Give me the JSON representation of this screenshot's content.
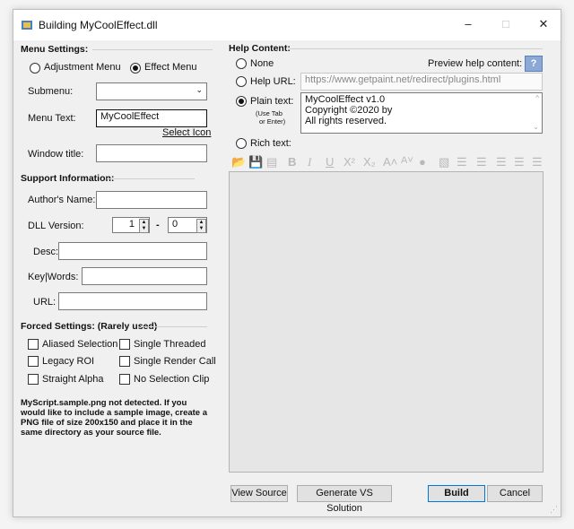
{
  "window": {
    "title": "Building MyCoolEffect.dll",
    "minimize_glyph": "–",
    "maximize_glyph": "□",
    "close_glyph": "✕"
  },
  "menu_settings": {
    "group_label": "Menu Settings:",
    "adjustment_label": "Adjustment Menu",
    "effect_label": "Effect Menu",
    "selected": "Effect Menu",
    "submenu_label": "Submenu:",
    "submenu_value": "",
    "menu_text_label": "Menu Text:",
    "menu_text_value": "MyCoolEffect",
    "select_icon_link": "Select Icon",
    "window_title_label": "Window title:",
    "window_title_value": ""
  },
  "support": {
    "group_label": "Support Information:",
    "author_label": "Author's Name:",
    "author_value": "",
    "dll_version_label": "DLL Version:",
    "version_major": "1",
    "version_sep": "-",
    "version_minor": "0",
    "desc_label": "Desc:",
    "keywords_label": "Key|Words:",
    "url_label": "URL:"
  },
  "forced": {
    "group_label": "Forced Settings: (Rarely used)",
    "aliased_selection": "Aliased Selection",
    "single_threaded": "Single Threaded",
    "legacy_roi": "Legacy ROI",
    "single_render_call": "Single Render Call",
    "straight_alpha": "Straight Alpha",
    "no_selection_clip": "No Selection Clip"
  },
  "sample_note": "MyScript.sample.png not detected.  If you would like to include a sample image, create a PNG file of size 200x150 and place it in the same directory as your source file.",
  "help": {
    "group_label": "Help Content:",
    "none_label": "None",
    "preview_label": "Preview help content:",
    "help_url_label": "Help URL:",
    "help_url_value": "https://www.getpaint.net/redirect/plugins.html",
    "plain_text_label": "Plain text:",
    "use_tab_note_1": "(Use Tab",
    "use_tab_note_2": "or Enter)",
    "plain_text_lines": [
      "MyCoolEffect v1.0",
      "Copyright ©2020 by",
      "All rights reserved."
    ],
    "rich_text_label": "Rich text:",
    "selected": "Plain text:",
    "toolbar_glyphs": [
      "📂",
      "💾",
      "▤",
      "B",
      "I",
      "U",
      "X²",
      "X₂",
      "A˄",
      "A˅",
      "●",
      "▧",
      "☰",
      "☰",
      "☰",
      "☰",
      "☰"
    ],
    "rich_editor_content": ""
  },
  "buttons": {
    "view_source": "View Source",
    "generate_vs": "Generate VS Solution",
    "build": "Build",
    "cancel": "Cancel"
  },
  "icons": [
    "app-icon",
    "help-icon",
    "chevron-down-icon",
    "spin-up-icon",
    "spin-down-icon",
    "size-grip-icon"
  ]
}
